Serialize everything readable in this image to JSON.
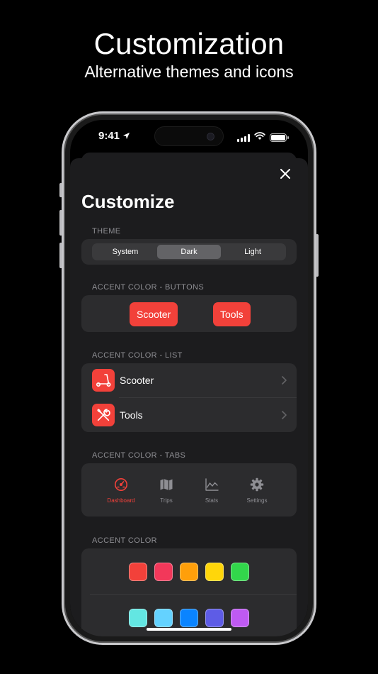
{
  "promo": {
    "title": "Customization",
    "subtitle": "Alternative themes and icons"
  },
  "status_bar": {
    "time": "9:41",
    "icons": [
      "location-arrow-icon",
      "signal-icon",
      "wifi-icon",
      "battery-icon"
    ]
  },
  "sheet": {
    "title": "Customize",
    "close_icon": "close-icon"
  },
  "theme": {
    "label": "THEME",
    "options": [
      "System",
      "Dark",
      "Light"
    ],
    "selected": "Dark"
  },
  "accent_buttons": {
    "label": "ACCENT COLOR - BUTTONS",
    "buttons": [
      "Scooter",
      "Tools"
    ]
  },
  "accent_list": {
    "label": "ACCENT COLOR - LIST",
    "items": [
      {
        "label": "Scooter",
        "icon": "scooter-icon"
      },
      {
        "label": "Tools",
        "icon": "tools-icon"
      }
    ]
  },
  "accent_tabs": {
    "label": "ACCENT COLOR - TABS",
    "tabs": [
      {
        "label": "Dashboard",
        "icon": "speedometer-icon",
        "active": true
      },
      {
        "label": "Trips",
        "icon": "map-icon",
        "active": false
      },
      {
        "label": "Stats",
        "icon": "chart-icon",
        "active": false
      },
      {
        "label": "Settings",
        "icon": "gear-icon",
        "active": false
      }
    ]
  },
  "accent_color": {
    "label": "ACCENT COLOR",
    "row1": [
      "#f2413a",
      "#f2385a",
      "#ff9f0a",
      "#ffd60a",
      "#32d74b"
    ],
    "row2": [
      "#63e6e2",
      "#64d2ff",
      "#0a84ff",
      "#5e5ce6",
      "#bf5af2"
    ]
  },
  "colors": {
    "accent": "#f2413a",
    "background": "#1c1c1e",
    "group": "#2c2c2e"
  }
}
